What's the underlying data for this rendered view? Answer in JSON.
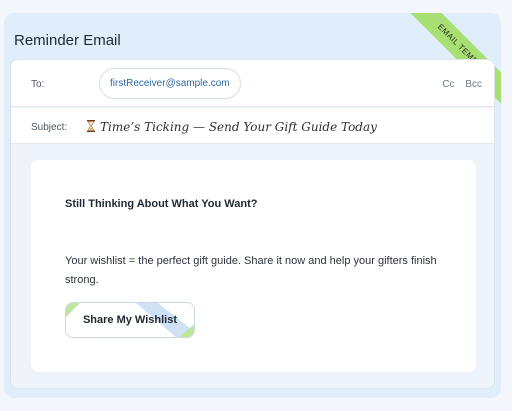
{
  "email": {
    "title": "Reminder Email",
    "ribbon": "EMAIL TEMPLATE",
    "to_label": "To:",
    "recipient": "firstReceiver@sample.com",
    "cc_label": "Cc",
    "bcc_label": "Bcc",
    "subject_label": "Subject:",
    "subject": "Time’s Ticking — Send Your Gift Guide Today"
  },
  "content": {
    "heading": "Still Thinking About What You Want?",
    "body": "Your wishlist = the perfect gift guide. Share it now and help your gifters finish strong.",
    "cta_label": "Share My Wishlist"
  },
  "colors": {
    "card_bg": "#dfeefa",
    "ribbon": "#a8df72",
    "link": "#2f6aa6",
    "accent_green": "#bfe6a0",
    "accent_blue": "#cfe2f5"
  },
  "icons": {
    "subject_prefix": "hourglass-icon"
  }
}
